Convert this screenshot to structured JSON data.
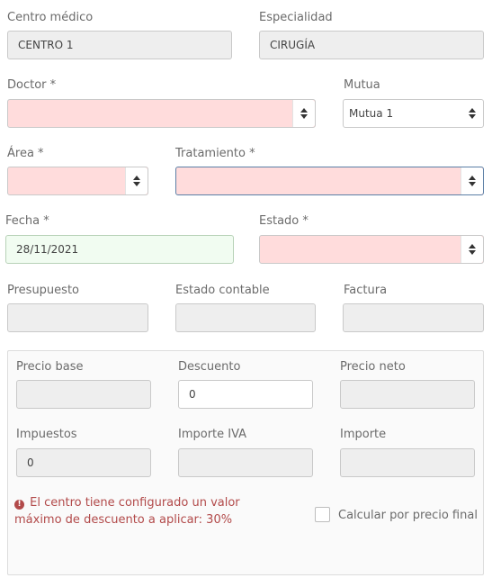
{
  "fields": {
    "centro": {
      "label": "Centro médico",
      "value": "CENTRO 1"
    },
    "especialidad": {
      "label": "Especialidad",
      "value": "CIRUGÍA"
    },
    "doctor": {
      "label": "Doctor *",
      "value": ""
    },
    "mutua": {
      "label": "Mutua",
      "value": "Mutua 1"
    },
    "area": {
      "label": "Área *",
      "value": ""
    },
    "tratamiento": {
      "label": "Tratamiento *",
      "value": ""
    },
    "fecha": {
      "label": "Fecha *",
      "value": "28/11/2021"
    },
    "estado": {
      "label": "Estado *",
      "value": ""
    },
    "presupuesto": {
      "label": "Presupuesto",
      "value": ""
    },
    "estado_contable": {
      "label": "Estado contable",
      "value": ""
    },
    "factura": {
      "label": "Factura",
      "value": ""
    }
  },
  "pricing": {
    "precio_base": {
      "label": "Precio base",
      "value": ""
    },
    "descuento": {
      "label": "Descuento",
      "value": "0"
    },
    "precio_neto": {
      "label": "Precio neto",
      "value": ""
    },
    "impuestos": {
      "label": "Impuestos",
      "value": "0"
    },
    "importe_iva": {
      "label": "Importe IVA",
      "value": ""
    },
    "importe": {
      "label": "Importe",
      "value": ""
    }
  },
  "warning": {
    "icon": "info-circle-icon",
    "text": "El centro tiene configurado un valor máximo de descuento a aplicar: 30%"
  },
  "calcular": {
    "label": "Calcular por precio final",
    "checked": false
  },
  "colors": {
    "required_empty": "#ffdcdc",
    "valid": "#f1fcf1",
    "disabled": "#eeeeee",
    "warning": "#b24a4a"
  }
}
